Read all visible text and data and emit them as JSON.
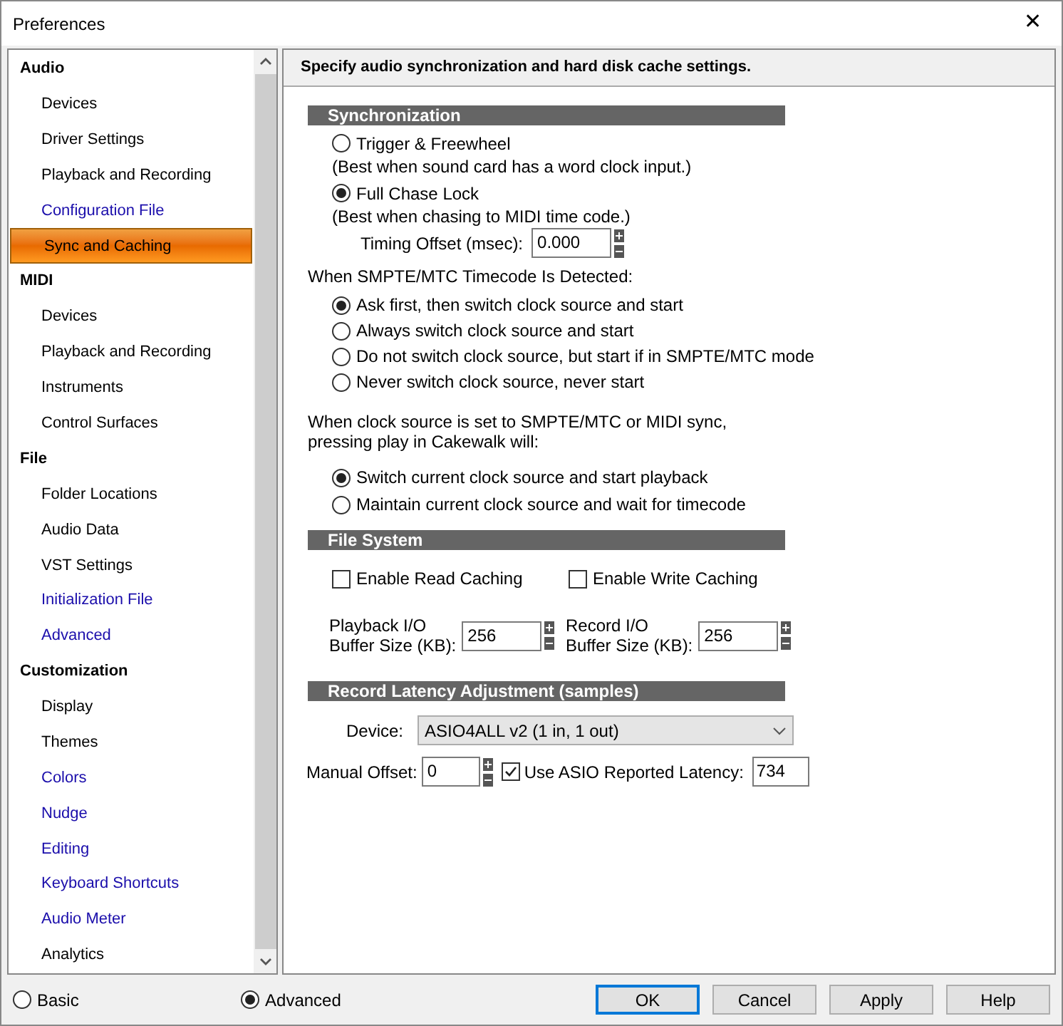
{
  "window": {
    "title": "Preferences",
    "close": "✕"
  },
  "sidebar": {
    "groups": [
      {
        "label": "Audio",
        "items": [
          {
            "label": "Devices",
            "selected": false,
            "color": "#000000"
          },
          {
            "label": "Driver Settings",
            "selected": false,
            "color": "#000000"
          },
          {
            "label": "Playback and Recording",
            "selected": false,
            "color": "#000000"
          },
          {
            "label": "Configuration File",
            "selected": false,
            "color": "#1a0dab"
          },
          {
            "label": "Sync and Caching",
            "selected": true,
            "color": "#000000"
          }
        ]
      },
      {
        "label": "MIDI",
        "items": [
          {
            "label": "Devices",
            "selected": false,
            "color": "#000000"
          },
          {
            "label": "Playback and Recording",
            "selected": false,
            "color": "#000000"
          },
          {
            "label": "Instruments",
            "selected": false,
            "color": "#000000"
          },
          {
            "label": "Control Surfaces",
            "selected": false,
            "color": "#000000"
          }
        ]
      },
      {
        "label": "File",
        "items": [
          {
            "label": "Folder Locations",
            "selected": false,
            "color": "#000000"
          },
          {
            "label": "Audio Data",
            "selected": false,
            "color": "#000000"
          },
          {
            "label": "VST Settings",
            "selected": false,
            "color": "#000000"
          },
          {
            "label": "Initialization File",
            "selected": false,
            "color": "#1a0dab"
          },
          {
            "label": "Advanced",
            "selected": false,
            "color": "#1a0dab"
          }
        ]
      },
      {
        "label": "Customization",
        "items": [
          {
            "label": "Display",
            "selected": false,
            "color": "#000000"
          },
          {
            "label": "Themes",
            "selected": false,
            "color": "#000000"
          },
          {
            "label": "Colors",
            "selected": false,
            "color": "#1a0dab"
          },
          {
            "label": "Nudge",
            "selected": false,
            "color": "#1a0dab"
          },
          {
            "label": "Editing",
            "selected": false,
            "color": "#1a0dab"
          },
          {
            "label": "Keyboard Shortcuts",
            "selected": false,
            "color": "#1a0dab"
          },
          {
            "label": "Audio Meter",
            "selected": false,
            "color": "#1a0dab"
          },
          {
            "label": "Analytics",
            "selected": false,
            "color": "#000000"
          }
        ]
      }
    ]
  },
  "header": "Specify audio synchronization and hard disk cache settings.",
  "synchronization": {
    "title": "Synchronization",
    "modes": [
      {
        "label": "Trigger & Freewheel",
        "note": "(Best when sound card has a word clock input.)",
        "selected": false
      },
      {
        "label": "Full Chase Lock",
        "note": "(Best when chasing to MIDI time code.)",
        "selected": true
      }
    ],
    "timing_offset": {
      "label": "Timing Offset (msec):",
      "value": "0.000"
    }
  },
  "smpte": {
    "label": "When SMPTE/MTC Timecode Is Detected:",
    "options": [
      {
        "label": "Ask first, then switch clock source and start",
        "selected": true
      },
      {
        "label": "Always switch clock source and start",
        "selected": false
      },
      {
        "label": "Do not switch clock source, but start if in SMPTE/MTC mode",
        "selected": false
      },
      {
        "label": "Never switch clock source, never start",
        "selected": false
      }
    ]
  },
  "clock_source": {
    "lines": [
      "When clock source is set to SMPTE/MTC or MIDI sync,",
      "pressing play in Cakewalk will:"
    ],
    "options": [
      {
        "label": "Switch current clock source and start playback",
        "selected": true
      },
      {
        "label": "Maintain current clock source and wait for timecode",
        "selected": false
      }
    ]
  },
  "file_system": {
    "title": "File System",
    "caching": [
      {
        "label": "Enable Read Caching",
        "checked": false
      },
      {
        "label": "Enable Write Caching",
        "checked": false
      }
    ],
    "buffers": [
      {
        "lines": [
          "Playback I/O",
          "Buffer Size (KB):"
        ],
        "value": "256"
      },
      {
        "lines": [
          "Record I/O",
          "Buffer Size (KB):"
        ],
        "value": "256"
      }
    ]
  },
  "latency": {
    "title": "Record Latency Adjustment (samples)",
    "device": {
      "label": "Device:",
      "value": "ASIO4ALL v2 (1 in, 1 out)"
    },
    "manual_offset": {
      "label": "Manual Offset:",
      "value": "0"
    },
    "use_asio": {
      "label": "Use ASIO Reported Latency:",
      "checked": true
    },
    "reported_latency": "734"
  },
  "footer": {
    "modes": [
      {
        "label": "Basic",
        "selected": false
      },
      {
        "label": "Advanced",
        "selected": true
      }
    ],
    "buttons": [
      {
        "label": "OK",
        "default": true
      },
      {
        "label": "Cancel",
        "default": false
      },
      {
        "label": "Apply",
        "default": false
      },
      {
        "label": "Help",
        "default": false
      }
    ]
  }
}
